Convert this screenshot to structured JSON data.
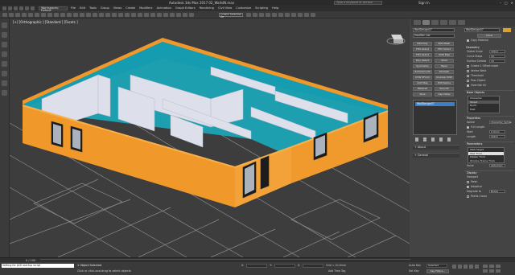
{
  "window": {
    "title": "Autodesk 3ds Max 2017    02_WallsIN.max",
    "search_placeholder": "Type a keyword or phrase",
    "signin": "Sign In"
  },
  "quick_access": {
    "workspace": "Workspaces: Default"
  },
  "menubar": {
    "items": [
      "File",
      "Edit",
      "Tools",
      "Group",
      "Views",
      "Create",
      "Modifiers",
      "Animation",
      "Graph Editors",
      "Rendering",
      "Civil View",
      "Customize",
      "Scripting",
      "Help"
    ]
  },
  "toolbar": {
    "selection_set": "Create Selection Se"
  },
  "viewport": {
    "label": "[+] [Orthographic ] [Standard ] [Facets ]",
    "colors": {
      "walls_exterior": "#f0982a",
      "walls_top": "#f0982a",
      "interior_walls": "#dde0ea",
      "floor": "#1f9fb0",
      "grid": "#9a9a9a",
      "window_frame": "#1c1c1c"
    }
  },
  "command_panel": {
    "object_name": "WallDesign07",
    "modifier_list": "Modifier List",
    "buttons": [
      "Edit Poly",
      "Edit Mesh",
      "FFD 2x2x2",
      "FFD 3x3x3",
      "FFD 4x4x4",
      "UVW Map",
      "Poly Select",
      "Shell",
      "Symmetry",
      "Taper",
      "TurboSmooth",
      "ZCmesh",
      "UVW XForm",
      "Unwrap UVW",
      "Unit Map",
      "Edit Spline",
      "Material",
      "Smooth",
      "Slice",
      "Cap Holes"
    ],
    "stack_item": "WallDesign07",
    "rollouts": {
      "about": "About",
      "general": "General"
    },
    "right": {
      "clone_label": "Clone",
      "copy_material": "Copy Material",
      "geometry_title": "Geometry",
      "params": [
        {
          "label": "Global Scale",
          "value": "100.0"
        },
        {
          "label": "Curve Steps",
          "value": "10"
        },
        {
          "label": "Surface Details",
          "value": "10"
        }
      ],
      "checks": [
        {
          "label": "Create 1 Offset mode",
          "on": false
        },
        {
          "label": "Vertex Weld",
          "on": false
        },
        {
          "label": "Threshold",
          "on": false
        },
        {
          "label": "Pass Object",
          "on": false
        },
        {
          "label": "Override UV",
          "on": true
        }
      ],
      "base_objects_title": "Base Objects",
      "base_objects": [
        "Character",
        "Street",
        "North",
        "East"
      ],
      "properties_title": "Properties",
      "spline_label": "Spline",
      "spline_value": "Character_Spline",
      "full_length": "Full Length",
      "start_label": "Start",
      "start_value": "0.0mm",
      "length_label": "Length",
      "length_value": "100.0",
      "params_title": "Parameters",
      "param_list": [
        "Wall Height",
        "Wall Thick",
        "Plaster Thick",
        "Window Frame Thick"
      ],
      "value_label": "Value",
      "value_value": "200.0mm",
      "display_title": "Display",
      "viewport_label": "Viewport",
      "mesh_label": "Mesh",
      "adaptive_label": "Adaptive",
      "degrade_label": "Degrade to",
      "degrade_value": "Boxes",
      "points_cloud": "Points Cloud"
    }
  },
  "timeline": {
    "frame": "0 / 100"
  },
  "statusbar": {
    "script": "Setting for ACD startup script",
    "selected": "1 Object Selected",
    "prompt": "Click or click-and-drag to select objects",
    "x_label": "X:",
    "y_label": "Y:",
    "z_label": "Z:",
    "grid": "Grid = 10.0mm",
    "add_time_tag": "Add Time Tag",
    "auto_key": "Auto Key",
    "set_key": "Set Key",
    "selected_dropdown": "Selected",
    "key_filters": "Key Filters..."
  }
}
